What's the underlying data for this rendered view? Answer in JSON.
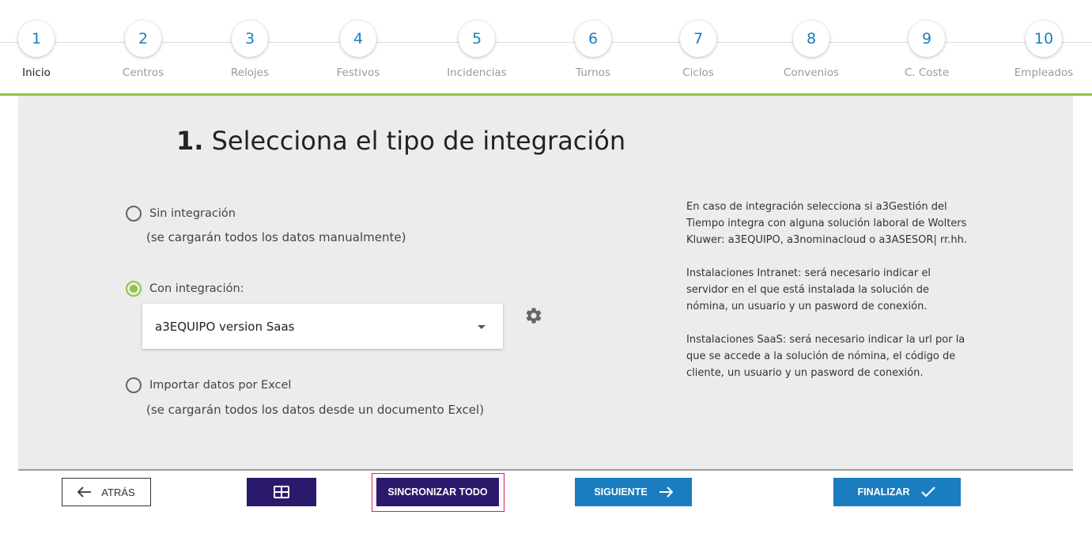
{
  "stepper": {
    "steps": [
      {
        "number": "1",
        "label": "Inicio"
      },
      {
        "number": "2",
        "label": "Centros"
      },
      {
        "number": "3",
        "label": "Relojes"
      },
      {
        "number": "4",
        "label": "Festivos"
      },
      {
        "number": "5",
        "label": "Incidencias"
      },
      {
        "number": "6",
        "label": "Turnos"
      },
      {
        "number": "7",
        "label": "Ciclos"
      },
      {
        "number": "8",
        "label": "Convenios"
      },
      {
        "number": "9",
        "label": "C. Coste"
      },
      {
        "number": "10",
        "label": "Empleados"
      }
    ],
    "active_step": "1",
    "accent_color": "#8dc63f",
    "number_color": "#1a7dc0"
  },
  "main": {
    "title_number": "1.",
    "title_text": "Selecciona el tipo de integración",
    "options": {
      "none": {
        "label": "Sin integración",
        "sub": "(se cargarán todos los datos manualmente)",
        "checked": false
      },
      "integration": {
        "label": "Con integración:",
        "checked": true
      },
      "excel": {
        "label": "Importar datos por Excel",
        "sub": "(se cargarán todos los datos desde un documento Excel)",
        "checked": false
      }
    },
    "integration_select": {
      "value": "a3EQUIPO version Saas"
    },
    "settings_icon": "gear-icon",
    "help": {
      "p1": "En caso de integración selecciona si a3Gestión del Tiempo integra con alguna solución laboral de Wolters Kluwer: a3EQUIPO, a3nominacloud o a3ASESOR| rr.hh.",
      "p2": "Instalaciones Intranet: será necesario indicar el servidor en el que está instalada la solución de nómina, un usuario y un pasword de conexión.",
      "p3": "Instalaciones SaaS: será necesario indicar la url por la que se accede a la solución de nómina, el código de cliente, un usuario y un pasword de conexión."
    }
  },
  "footer": {
    "back_label": "ATRÁS",
    "grid_icon": "grid-icon",
    "sync_label": "SINCRONIZAR TODO",
    "next_label": "SIGUIENTE",
    "finish_label": "FINALIZAR",
    "primary_color": "#1a7dc0",
    "dark_color": "#2b1a6b",
    "highlight_color": "#d6205f"
  }
}
